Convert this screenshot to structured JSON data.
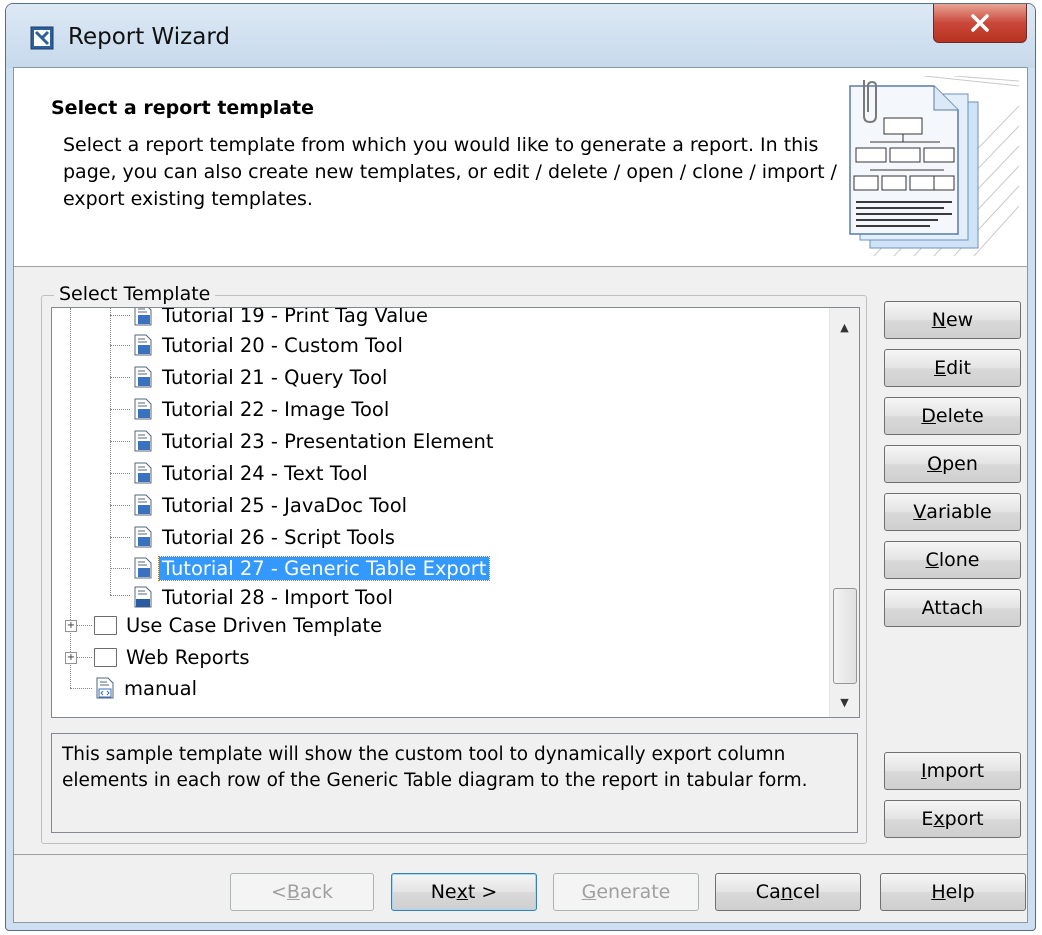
{
  "window": {
    "title": "Report Wizard"
  },
  "header": {
    "title": "Select a report template",
    "description": "Select a report template from which you would like to generate a report. In this page, you can also create new templates, or edit / delete / open / clone / import / export existing templates."
  },
  "group_label": "Select Template",
  "tree": {
    "items": [
      {
        "label": "Tutorial 19 - Print Tag Value",
        "icon": "template-doc-icon"
      },
      {
        "label": "Tutorial 20 - Custom Tool",
        "icon": "template-doc-icon"
      },
      {
        "label": "Tutorial 21 - Query Tool",
        "icon": "template-doc-icon"
      },
      {
        "label": "Tutorial 22 - Image Tool",
        "icon": "template-doc-icon"
      },
      {
        "label": "Tutorial 23 - Presentation Element",
        "icon": "template-doc-icon"
      },
      {
        "label": "Tutorial 24 - Text Tool",
        "icon": "template-doc-icon"
      },
      {
        "label": "Tutorial 25 - JavaDoc Tool",
        "icon": "template-doc-icon"
      },
      {
        "label": "Tutorial 26 - Script Tools",
        "icon": "template-doc-icon"
      },
      {
        "label": "Tutorial 27 - Generic Table Export",
        "icon": "template-doc-icon",
        "selected": true
      },
      {
        "label": "Tutorial 28 - Import Tool",
        "icon": "rtf-doc-icon"
      },
      {
        "label": "Use Case Driven Template",
        "icon": "folder-icon"
      },
      {
        "label": "Web Reports",
        "icon": "folder-icon"
      },
      {
        "label": "manual",
        "icon": "xml-doc-icon"
      }
    ]
  },
  "description_box": "This sample template will show the custom tool to dynamically export column elements in each row of the Generic Table diagram to the report in tabular form.",
  "side_buttons": {
    "new": {
      "pre": "",
      "key": "N",
      "post": "ew"
    },
    "edit": {
      "pre": "",
      "key": "E",
      "post": "dit"
    },
    "delete": {
      "pre": "",
      "key": "D",
      "post": "elete"
    },
    "open": {
      "pre": "",
      "key": "O",
      "post": "pen"
    },
    "variable": {
      "pre": "",
      "key": "V",
      "post": "ariable"
    },
    "clone": {
      "pre": "",
      "key": "C",
      "post": "lone"
    },
    "attach": {
      "pre": "Attach",
      "key": "",
      "post": ""
    },
    "import": {
      "pre": "",
      "key": "I",
      "post": "mport"
    },
    "export": {
      "pre": "E",
      "key": "x",
      "post": "port"
    }
  },
  "footer_buttons": {
    "back": {
      "pre": "< ",
      "key": "B",
      "post": "ack"
    },
    "next": {
      "pre": "Ne",
      "key": "x",
      "post": "t >"
    },
    "generate": {
      "pre": "",
      "key": "G",
      "post": "enerate"
    },
    "cancel": {
      "pre": "Ca",
      "key": "n",
      "post": "cel"
    },
    "help": {
      "pre": "",
      "key": "H",
      "post": "elp"
    }
  },
  "colors": {
    "selection": "#3399ff",
    "close_button": "#c9483a",
    "frame": "#cddff0"
  }
}
